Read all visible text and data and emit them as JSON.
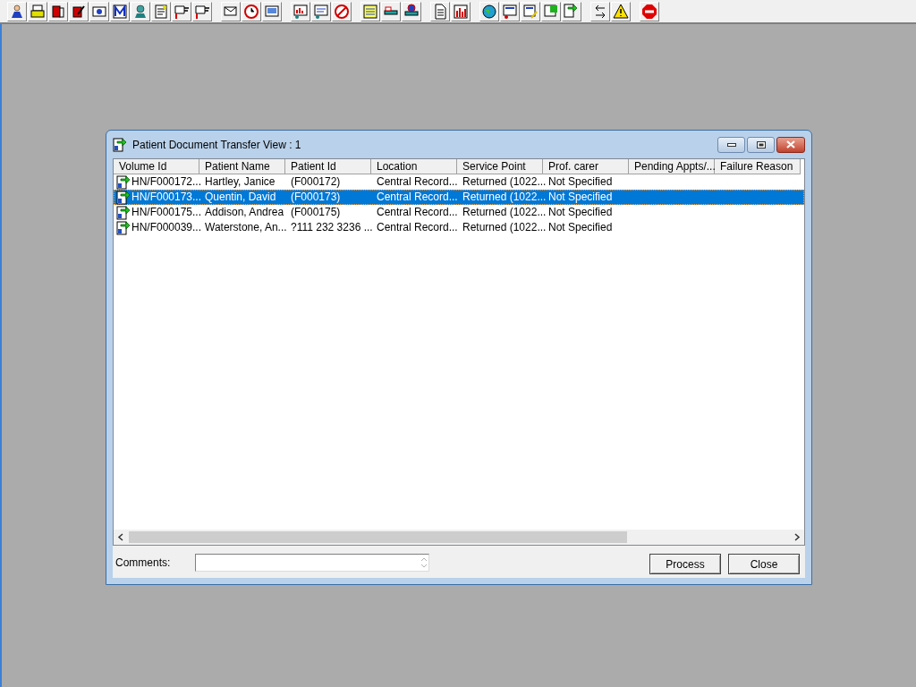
{
  "window": {
    "title": "Patient Document Transfer View : 1"
  },
  "table": {
    "columns": [
      "Volume Id",
      "Patient Name",
      "Patient Id",
      "Location",
      "Service Point",
      "Prof. carer",
      "Pending Appts/...",
      "Failure Reason"
    ],
    "rows": [
      {
        "selected": false,
        "cells": [
          "HN/F000172...",
          "Hartley, Janice",
          "(F000172)",
          "Central Record...",
          "Returned (1022...",
          "Not Specified"
        ]
      },
      {
        "selected": true,
        "cells": [
          "HN/F000173...",
          "Quentin, David",
          "(F000173)",
          "Central Record...",
          "Returned (1022...",
          "Not Specified"
        ]
      },
      {
        "selected": false,
        "cells": [
          "HN/F000175...",
          "Addison, Andrea",
          "(F000175)",
          "Central Record...",
          "Returned (1022...",
          "Not Specified"
        ]
      },
      {
        "selected": false,
        "cells": [
          "HN/F000039...",
          "Waterstone, An...",
          "?111 232 3236 ...",
          "Central Record...",
          "Returned (1022...",
          "Not Specified"
        ]
      }
    ]
  },
  "comments": {
    "label": "Comments:"
  },
  "buttons": [
    "Process",
    "Close"
  ]
}
